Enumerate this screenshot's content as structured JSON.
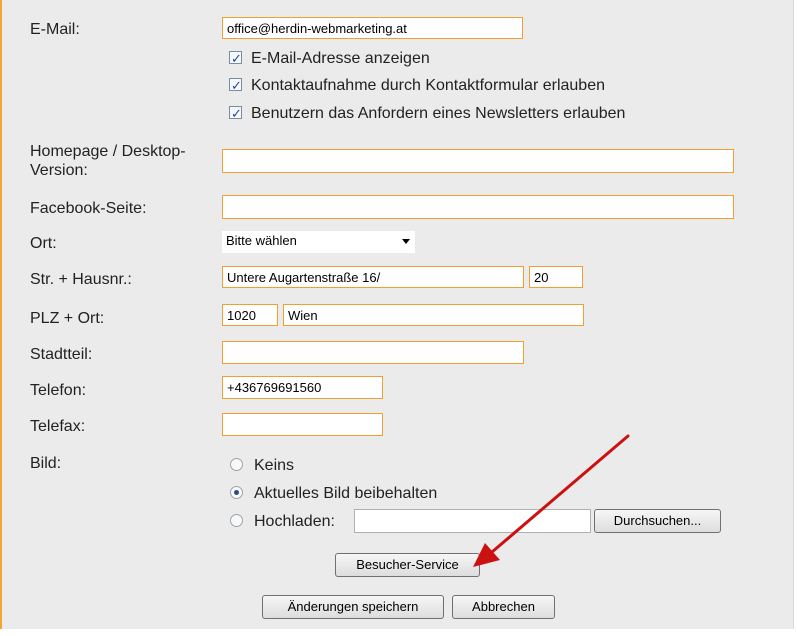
{
  "email": {
    "label": "E-Mail:",
    "value": "office@herdin-webmarketing.at",
    "options": [
      {
        "label": "E-Mail-Adresse anzeigen",
        "checked": true
      },
      {
        "label": "Kontaktaufnahme durch Kontaktformular erlauben",
        "checked": true
      },
      {
        "label": "Benutzern das Anfordern eines Newsletters erlauben",
        "checked": true
      }
    ]
  },
  "homepage": {
    "label_line1": "Homepage / Desktop-",
    "label_line2": "Version:",
    "value": ""
  },
  "facebook": {
    "label": "Facebook-Seite:",
    "value": ""
  },
  "ort": {
    "label": "Ort:",
    "selected": "Bitte wählen"
  },
  "street": {
    "label": "Str. + Hausnr.:",
    "street_value": "Untere Augartenstraße 16/",
    "number_value": "20"
  },
  "plz": {
    "label": "PLZ + Ort:",
    "plz_value": "1020",
    "city_value": "Wien"
  },
  "district": {
    "label": "Stadtteil:",
    "value": ""
  },
  "phone": {
    "label": "Telefon:",
    "value": "+436769691560"
  },
  "fax": {
    "label": "Telefax:",
    "value": ""
  },
  "image": {
    "label": "Bild:",
    "options": [
      {
        "label": "Keins",
        "selected": false
      },
      {
        "label": "Aktuelles Bild beibehalten",
        "selected": true
      },
      {
        "label": "Hochladen:",
        "selected": false
      }
    ],
    "upload_value": "",
    "browse_label": "Durchsuchen..."
  },
  "buttons": {
    "visitor_service": "Besucher-Service",
    "save": "Änderungen speichern",
    "cancel": "Abbrechen"
  },
  "colors": {
    "input_border": "#f0a030",
    "panel_bg": "#ebebeb",
    "arrow": "#cc1111"
  }
}
